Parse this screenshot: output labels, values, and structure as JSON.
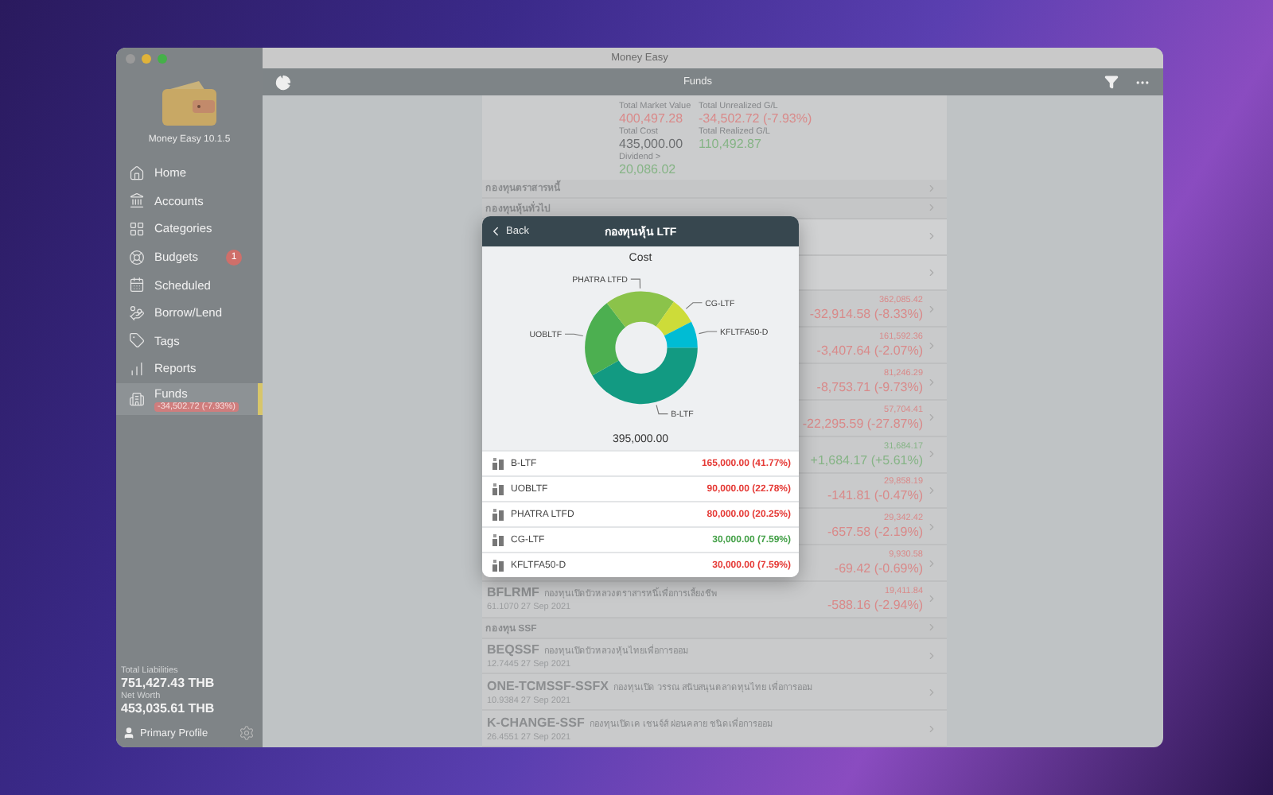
{
  "window": {
    "title": "Money Easy"
  },
  "sidebar": {
    "app_version": "Money Easy 10.1.5",
    "items": [
      {
        "label": "Home",
        "selected": false
      },
      {
        "label": "Accounts",
        "selected": false
      },
      {
        "label": "Categories",
        "selected": false
      },
      {
        "label": "Budgets",
        "badge": "1",
        "selected": false
      },
      {
        "label": "Scheduled",
        "selected": false
      },
      {
        "label": "Borrow/Lend",
        "selected": false
      },
      {
        "label": "Tags",
        "selected": false
      },
      {
        "label": "Reports",
        "selected": false
      },
      {
        "label": "Funds",
        "sub": "-34,502.72 (-7.93%)",
        "selected": true
      }
    ],
    "totals": [
      {
        "label": "Total Liabilities",
        "value": "751,427.43 THB"
      },
      {
        "label": "Net Worth",
        "value": "453,035.61 THB"
      }
    ],
    "profile": "Primary Profile"
  },
  "toolbar": {
    "title": "Funds"
  },
  "summary": [
    {
      "label": "Total Market Value",
      "value": "400,497.28",
      "color": "#d98a8a"
    },
    {
      "label": "Total Unrealized G/L",
      "value": "-34,502.72 (-7.93%)",
      "color": "#d98a8a"
    },
    {
      "label": "Total Cost",
      "value": "435,000.00",
      "color": "#6e7072"
    },
    {
      "label": "Total Realized G/L",
      "value": "110,492.87",
      "color": "#86b486"
    },
    {
      "label": "Dividend >",
      "value": "20,086.02",
      "color": "#86b486"
    }
  ],
  "list": [
    {
      "kind": "header",
      "label": "กองทุนตราสารหนี้"
    },
    {
      "kind": "header",
      "label": "กองทุนหุ้นทั่วไป"
    },
    {
      "kind": "covered"
    },
    {
      "kind": "covered"
    },
    {
      "kind": "fund",
      "value": "362,085.42",
      "change": "-32,914.58 (-8.33%)",
      "color": "#d98a8a"
    },
    {
      "kind": "fund",
      "value": "161,592.36",
      "change": "-3,407.64 (-2.07%)",
      "color": "#d98a8a"
    },
    {
      "kind": "fund",
      "value": "81,246.29",
      "change": "-8,753.71 (-9.73%)",
      "color": "#d98a8a"
    },
    {
      "kind": "fund",
      "value": "57,704.41",
      "change": "-22,295.59 (-27.87%)",
      "color": "#d98a8a"
    },
    {
      "kind": "fund",
      "value": "31,684.17",
      "change": "+1,684.17 (+5.61%)",
      "color": "#86b486"
    },
    {
      "kind": "fund",
      "value": "29,858.19",
      "change": "-141.81 (-0.47%)",
      "color": "#d98a8a"
    },
    {
      "kind": "fund",
      "value": "29,342.42",
      "change": "-657.58 (-2.19%)",
      "color": "#d98a8a"
    },
    {
      "kind": "fund",
      "value": "9,930.58",
      "change": "-69.42 (-0.69%)",
      "color": "#d98a8a"
    },
    {
      "kind": "fund",
      "name": "BFLRMF",
      "description": "กองทุนเปิดบัวหลวงตราสารหนี้เพื่อการเลี้ยงชีพ",
      "nav": "61.1070",
      "date": "27 Sep 2021",
      "value": "19,411.84",
      "change": "-588.16 (-2.94%)",
      "color": "#d98a8a"
    },
    {
      "kind": "header",
      "label": "กองทุน SSF"
    },
    {
      "kind": "fund",
      "name": "BEQSSF",
      "description": "กองทุนเปิดบัวหลวงหุ้นไทยเพื่อการออม",
      "nav": "12.7445",
      "date": "27 Sep 2021"
    },
    {
      "kind": "fund",
      "name": "ONE-TCMSSF-SSFX",
      "description": "กองทุนเปิด วรรณ สนับสนุนตลาดทุนไทย เพื่อการออม",
      "nav": "10.9384",
      "date": "27 Sep 2021"
    },
    {
      "kind": "fund",
      "name": "K-CHANGE-SSF",
      "description": "กองทุนเปิดเค เชนจ์ส์ ผ่อนคลาย ชนิดเพื่อการออม",
      "nav": "26.4551",
      "date": "27 Sep 2021"
    }
  ],
  "popup": {
    "back": "Back",
    "title": "กองทุนหุ้น LTF",
    "total": "395,000.00",
    "chart_data": {
      "type": "donut",
      "title": "Cost",
      "categories": [
        "B-LTF",
        "UOBLTF",
        "PHATRA LTFD",
        "CG-LTF",
        "KFLTFA50-D"
      ],
      "values": [
        41.77,
        22.78,
        20.25,
        7.59,
        7.59
      ],
      "colors": [
        "#129a82",
        "#4caf50",
        "#8bc34a",
        "#cddc39",
        "#00bcd4"
      ]
    },
    "rows": [
      {
        "name": "B-LTF",
        "amount": "165,000.00 (41.77%)",
        "color": "#e53935"
      },
      {
        "name": "UOBLTF",
        "amount": "90,000.00 (22.78%)",
        "color": "#e53935"
      },
      {
        "name": "PHATRA LTFD",
        "amount": "80,000.00 (20.25%)",
        "color": "#e53935"
      },
      {
        "name": "CG-LTF",
        "amount": "30,000.00 (7.59%)",
        "color": "#43a047"
      },
      {
        "name": "KFLTFA50-D",
        "amount": "30,000.00 (7.59%)",
        "color": "#e53935"
      }
    ]
  }
}
